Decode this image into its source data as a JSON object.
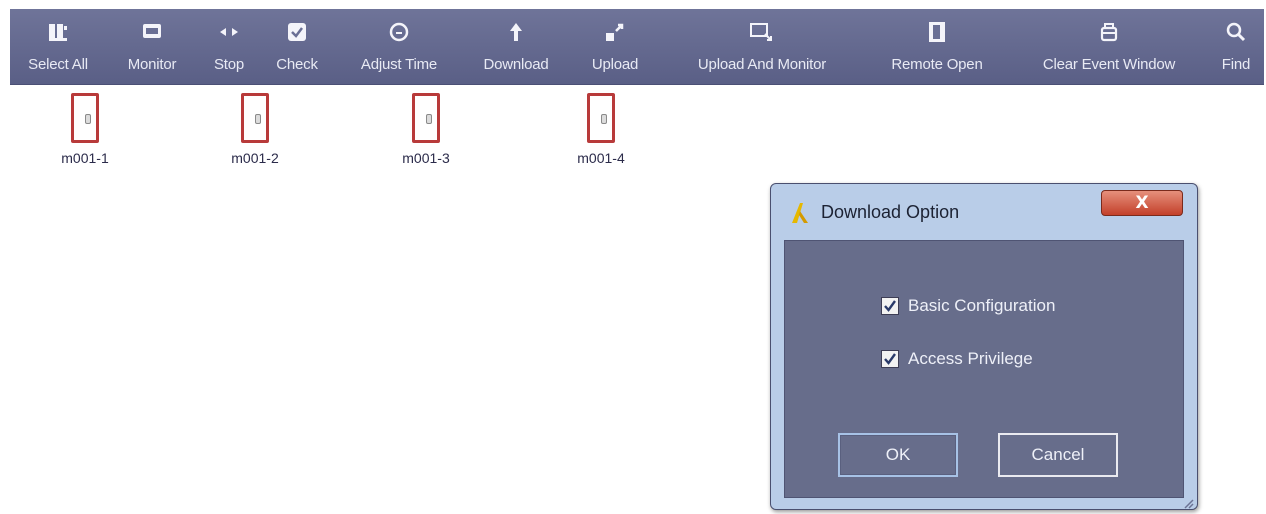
{
  "toolbar": {
    "items": [
      {
        "label": "Select All",
        "icon": "select-all-icon"
      },
      {
        "label": "Monitor",
        "icon": "monitor-icon"
      },
      {
        "label": "Stop",
        "icon": "stop-icon"
      },
      {
        "label": "Check",
        "icon": "check-icon"
      },
      {
        "label": "Adjust Time",
        "icon": "clock-icon"
      },
      {
        "label": "Download",
        "icon": "download-arrow-icon"
      },
      {
        "label": "Upload",
        "icon": "upload-icon"
      },
      {
        "label": "Upload And Monitor",
        "icon": "upload-monitor-icon"
      },
      {
        "label": "Remote Open",
        "icon": "remote-open-icon"
      },
      {
        "label": "Clear Event Window",
        "icon": "clear-event-icon"
      },
      {
        "label": "Find",
        "icon": "find-icon"
      }
    ]
  },
  "doors": [
    {
      "label": "m001-1"
    },
    {
      "label": "m001-2"
    },
    {
      "label": "m001-3"
    },
    {
      "label": "m001-4"
    }
  ],
  "dialog": {
    "title": "Download Option",
    "close_label": "X",
    "options": [
      {
        "label": "Basic Configuration",
        "checked": true
      },
      {
        "label": "Access Privilege",
        "checked": true
      }
    ],
    "ok_label": "OK",
    "cancel_label": "Cancel"
  },
  "colors": {
    "toolbar_bg": "#63688f",
    "door_border": "#b83a3a",
    "dialog_frame": "#b9cde8",
    "dialog_body": "#676d8b",
    "close_button": "#c3402a"
  }
}
